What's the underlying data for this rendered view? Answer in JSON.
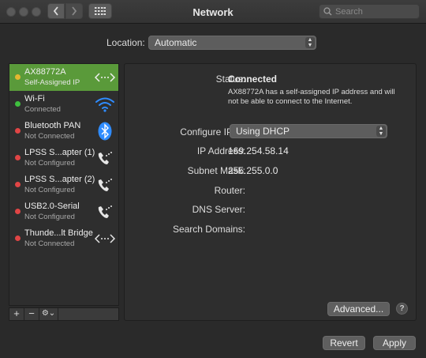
{
  "window": {
    "title": "Network"
  },
  "search": {
    "placeholder": "Search"
  },
  "location": {
    "label": "Location:",
    "value": "Automatic"
  },
  "services": [
    {
      "name": "AX88772A",
      "status": "Self-Assigned IP",
      "dot": "#e3b730",
      "icon": "ethernet-icon",
      "selected": true
    },
    {
      "name": "Wi-Fi",
      "status": "Connected",
      "dot": "#3fbf3f",
      "icon": "wifi-icon",
      "selected": false
    },
    {
      "name": "Bluetooth PAN",
      "status": "Not Connected",
      "dot": "#e04545",
      "icon": "bluetooth-icon",
      "selected": false
    },
    {
      "name": "LPSS S...apter (1)",
      "status": "Not Configured",
      "dot": "#e04545",
      "icon": "phone-icon",
      "selected": false
    },
    {
      "name": "LPSS S...apter (2)",
      "status": "Not Configured",
      "dot": "#e04545",
      "icon": "phone-icon",
      "selected": false
    },
    {
      "name": "USB2.0-Serial",
      "status": "Not Configured",
      "dot": "#e04545",
      "icon": "phone-icon",
      "selected": false
    },
    {
      "name": "Thunde...lt Bridge",
      "status": "Not Connected",
      "dot": "#e04545",
      "icon": "ethernet-icon",
      "selected": false
    }
  ],
  "toolbar": {
    "add": "+",
    "remove": "−",
    "gear": "⚙⌄"
  },
  "detail": {
    "status_label": "Status:",
    "status_value": "Connected",
    "status_note": "AX88772A has a self-assigned IP address and will not be able to connect to the Internet.",
    "ipv4_label": "Configure IPv4:",
    "ipv4_value": "Using DHCP",
    "ip_label": "IP Address:",
    "ip_value": "169.254.58.14",
    "mask_label": "Subnet Mask:",
    "mask_value": "255.255.0.0",
    "router_label": "Router:",
    "dns_label": "DNS Server:",
    "domains_label": "Search Domains:",
    "advanced": "Advanced...",
    "help": "?"
  },
  "footer": {
    "revert": "Revert",
    "apply": "Apply"
  },
  "colors": {
    "selected": "#5a9a3a",
    "wifi": "#2f8cff",
    "bluetooth": "#2f8cff"
  }
}
